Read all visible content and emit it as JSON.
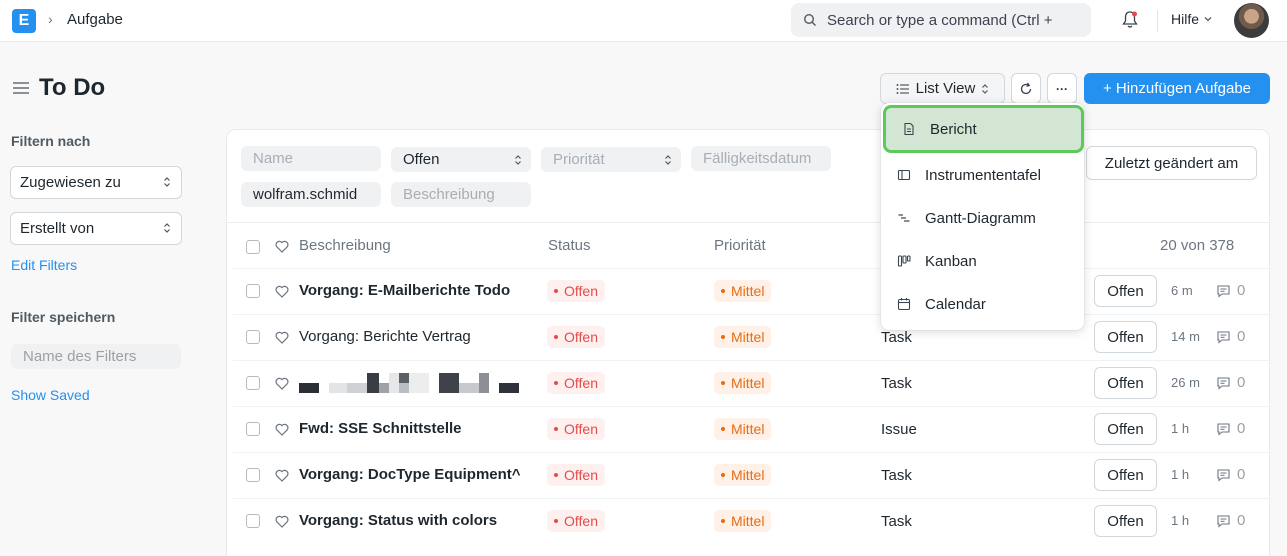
{
  "navbar": {
    "logo": "E",
    "breadcrumb_sep": "›",
    "breadcrumb": "Aufgabe",
    "search_placeholder": "Search or type a command (Ctrl +",
    "help": "Hilfe"
  },
  "page": {
    "title": "To Do",
    "list_view": "List View",
    "add_button": "+ Hinzufügen Aufgabe",
    "more": "···"
  },
  "sidebar": {
    "filter_heading": "Filtern nach",
    "assigned_to": "Zugewiesen zu",
    "created_by": "Erstellt von",
    "edit_filters": "Edit Filters",
    "save_heading": "Filter speichern",
    "filter_name_placeholder": "Name des Filters",
    "show_saved": "Show Saved"
  },
  "filters": {
    "name_placeholder": "Name",
    "status": "Offen",
    "priority_placeholder": "Priorität",
    "due_date_placeholder": "Fälligkeitsdatum",
    "owner": "wolfram.schmid",
    "description_placeholder": "Beschreibung",
    "sort": "Zuletzt geändert am"
  },
  "table": {
    "col_description": "Beschreibung",
    "col_status": "Status",
    "col_priority": "Priorität",
    "count": "20 von 378",
    "rows": [
      {
        "subject": "Vorgang: E-Mailberichte Todo",
        "bold": true,
        "status": "Offen",
        "priority": "Mittel",
        "type": "",
        "status_btn": "Offen",
        "time": "6 m",
        "comments": "0"
      },
      {
        "subject": "Vorgang: Berichte Vertrag",
        "bold": false,
        "status": "Offen",
        "priority": "Mittel",
        "type": "Task",
        "status_btn": "Offen",
        "time": "14 m",
        "comments": "0"
      },
      {
        "subject": "",
        "bold": false,
        "status": "Offen",
        "priority": "Mittel",
        "type": "Task",
        "status_btn": "Offen",
        "time": "26 m",
        "comments": "0"
      },
      {
        "subject": "Fwd: SSE Schnittstelle",
        "bold": true,
        "status": "Offen",
        "priority": "Mittel",
        "type": "Issue",
        "status_btn": "Offen",
        "time": "1 h",
        "comments": "0"
      },
      {
        "subject": "Vorgang: DocType Equipment^",
        "bold": true,
        "status": "Offen",
        "priority": "Mittel",
        "type": "Task",
        "status_btn": "Offen",
        "time": "1 h",
        "comments": "0"
      },
      {
        "subject": "Vorgang: Status with colors",
        "bold": true,
        "status": "Offen",
        "priority": "Mittel",
        "type": "Task",
        "status_btn": "Offen",
        "time": "1 h",
        "comments": "0"
      }
    ]
  },
  "view_menu": {
    "items": [
      {
        "label": "Bericht",
        "icon": "report-icon"
      },
      {
        "label": "Instrumententafel",
        "icon": "dashboard-icon"
      },
      {
        "label": "Gantt-Diagramm",
        "icon": "gantt-icon"
      },
      {
        "label": "Kanban",
        "icon": "kanban-icon"
      },
      {
        "label": "Calendar",
        "icon": "calendar-icon"
      }
    ]
  },
  "colors": {
    "accent": "#2490ef",
    "status_red": "#e24c4c",
    "priority_orange": "#e86c13",
    "highlight_border": "#5bc95b"
  }
}
